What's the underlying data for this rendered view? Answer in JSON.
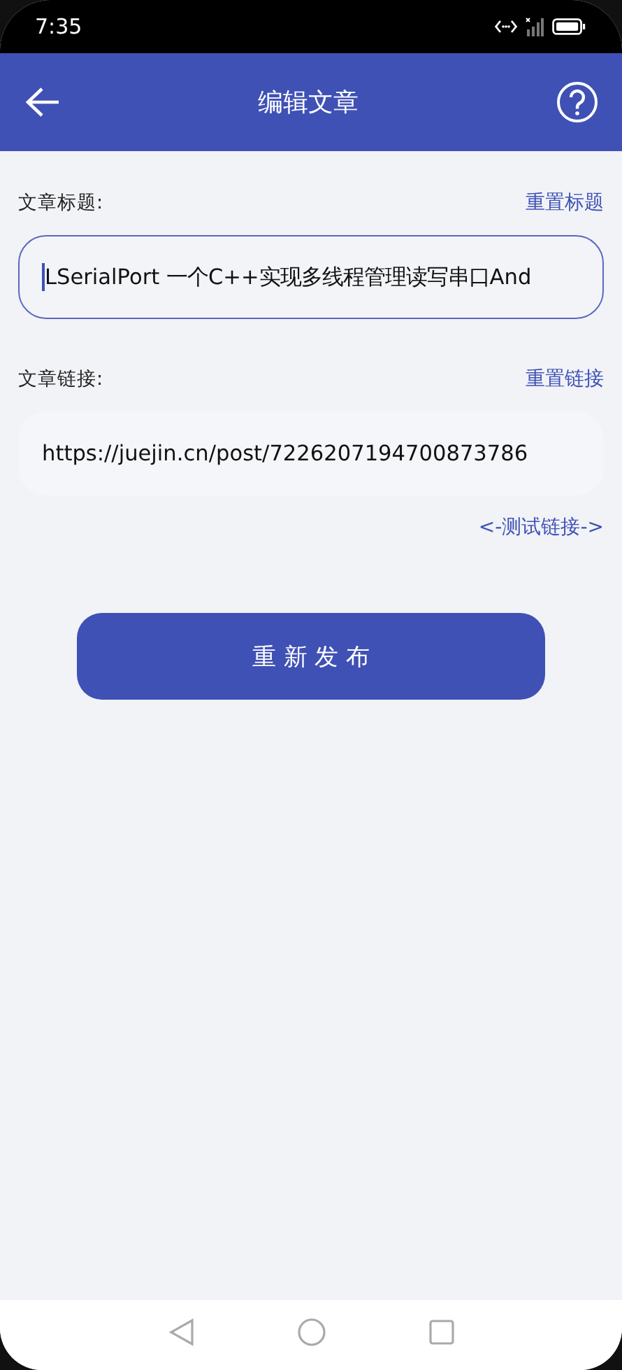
{
  "status_bar": {
    "time": "7:35"
  },
  "app_bar": {
    "title": "编辑文章"
  },
  "fields": [
    {
      "label": "文章标题:",
      "action": "重置标题",
      "value": "LSerialPort 一个C++实现多线程管理读写串口And",
      "focused": true
    },
    {
      "label": "文章链接:",
      "action": "重置链接",
      "value": "https://juejin.cn/post/7226207194700873786",
      "focused": false
    }
  ],
  "test_link": "<-测试链接->",
  "publish_button": "重 新 发 布"
}
